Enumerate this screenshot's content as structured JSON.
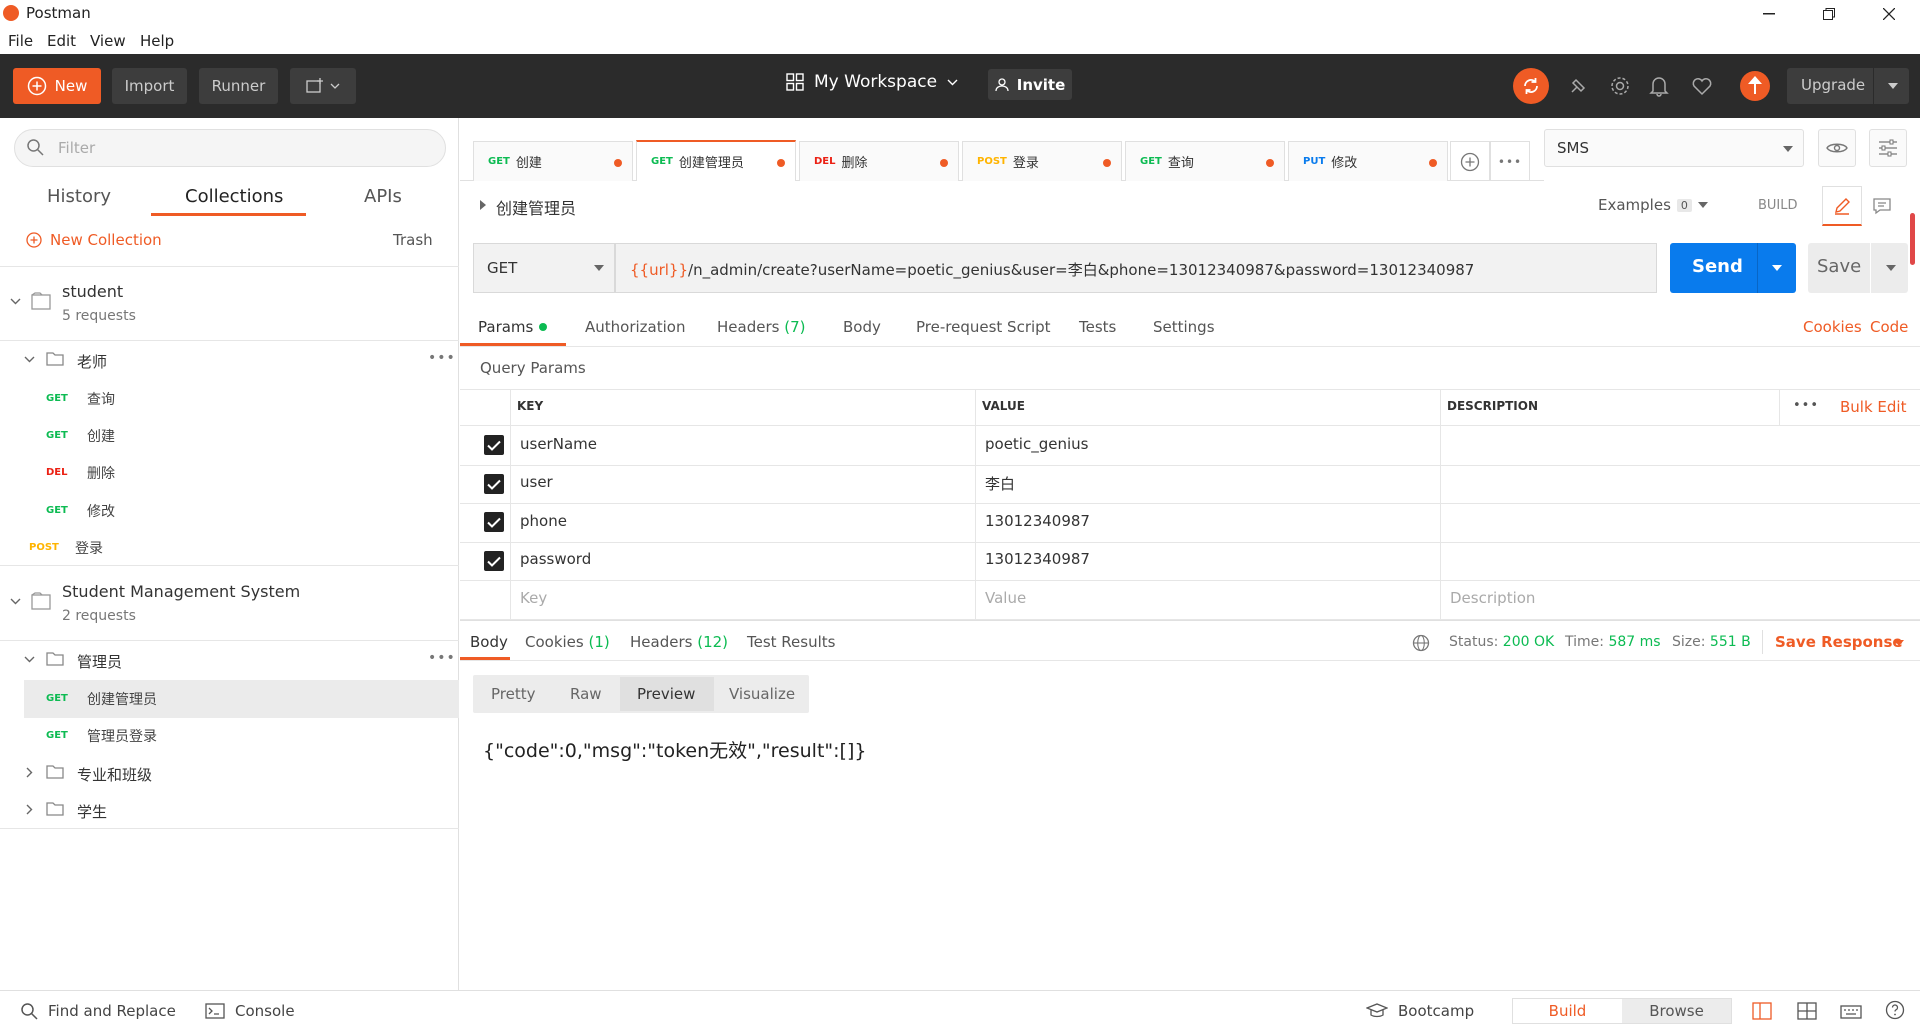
{
  "window": {
    "title": "Postman",
    "menu": [
      "File",
      "Edit",
      "View",
      "Help"
    ]
  },
  "toolbar": {
    "new_label": "New",
    "import_label": "Import",
    "runner_label": "Runner",
    "workspace": "My Workspace",
    "invite_label": "Invite",
    "upgrade_label": "Upgrade"
  },
  "sidebar": {
    "filter_placeholder": "Filter",
    "tabs": [
      "History",
      "Collections",
      "APIs"
    ],
    "new_collection": "New Collection",
    "trash": "Trash",
    "collections": [
      {
        "name": "student",
        "count": "5 requests",
        "folder": "老师",
        "requests": [
          {
            "method": "GET",
            "name": "查询"
          },
          {
            "method": "GET",
            "name": "创建"
          },
          {
            "method": "DEL",
            "name": "删除"
          },
          {
            "method": "GET",
            "name": "修改"
          }
        ],
        "root_request": {
          "method": "POST",
          "name": "登录"
        }
      },
      {
        "name": "Student Management System",
        "count": "2 requests",
        "folder": "管理员",
        "requests": [
          {
            "method": "GET",
            "name": "创建管理员"
          },
          {
            "method": "GET",
            "name": "管理员登录"
          }
        ],
        "folders": [
          "专业和班级",
          "学生"
        ]
      }
    ]
  },
  "request_tabs": [
    {
      "method": "GET",
      "name": "创建"
    },
    {
      "method": "GET",
      "name": "创建管理员"
    },
    {
      "method": "DEL",
      "name": "删除"
    },
    {
      "method": "POST",
      "name": "登录"
    },
    {
      "method": "GET",
      "name": "查询"
    },
    {
      "method": "PUT",
      "name": "修改"
    }
  ],
  "environment": "SMS",
  "request": {
    "title": "创建管理员",
    "examples_label": "Examples",
    "examples_count": "0",
    "build_label": "BUILD",
    "method": "GET",
    "url_var": "{{url}}",
    "url_rest": "/n_admin/create?userName=poetic_genius&user=李白&phone=13012340987&password=13012340987",
    "send_label": "Send",
    "save_label": "Save"
  },
  "param_tabs": {
    "params": "Params",
    "authorization": "Authorization",
    "headers": "Headers",
    "headers_count": "(7)",
    "body": "Body",
    "prerequest": "Pre-request Script",
    "tests": "Tests",
    "settings": "Settings",
    "cookies": "Cookies",
    "code": "Code"
  },
  "query_params": {
    "label": "Query Params",
    "headers": {
      "key": "KEY",
      "value": "VALUE",
      "description": "DESCRIPTION",
      "bulk_edit": "Bulk Edit"
    },
    "rows": [
      {
        "key": "userName",
        "value": "poetic_genius"
      },
      {
        "key": "user",
        "value": "李白"
      },
      {
        "key": "phone",
        "value": "13012340987"
      },
      {
        "key": "password",
        "value": "13012340987"
      }
    ],
    "placeholders": {
      "key": "Key",
      "value": "Value",
      "description": "Description"
    }
  },
  "response": {
    "tabs": {
      "body": "Body",
      "cookies": "Cookies",
      "cookies_count": "(1)",
      "headers": "Headers",
      "headers_count": "(12)",
      "tests": "Test Results"
    },
    "status_label": "Status:",
    "status": "200 OK",
    "time_label": "Time:",
    "time": "587 ms",
    "size_label": "Size:",
    "size": "551 B",
    "save_response": "Save Response",
    "formats": [
      "Pretty",
      "Raw",
      "Preview",
      "Visualize"
    ],
    "body": "{\"code\":0,\"msg\":\"token无效\",\"result\":[]}"
  },
  "statusbar": {
    "find_replace": "Find and Replace",
    "console": "Console",
    "bootcamp": "Bootcamp",
    "build": "Build",
    "browse": "Browse"
  },
  "colors": {
    "accent": "#ef5b25",
    "send": "#097bed",
    "get": "#0cbb52",
    "del": "#eb2013",
    "post": "#ffb400",
    "put": "#097bed"
  }
}
